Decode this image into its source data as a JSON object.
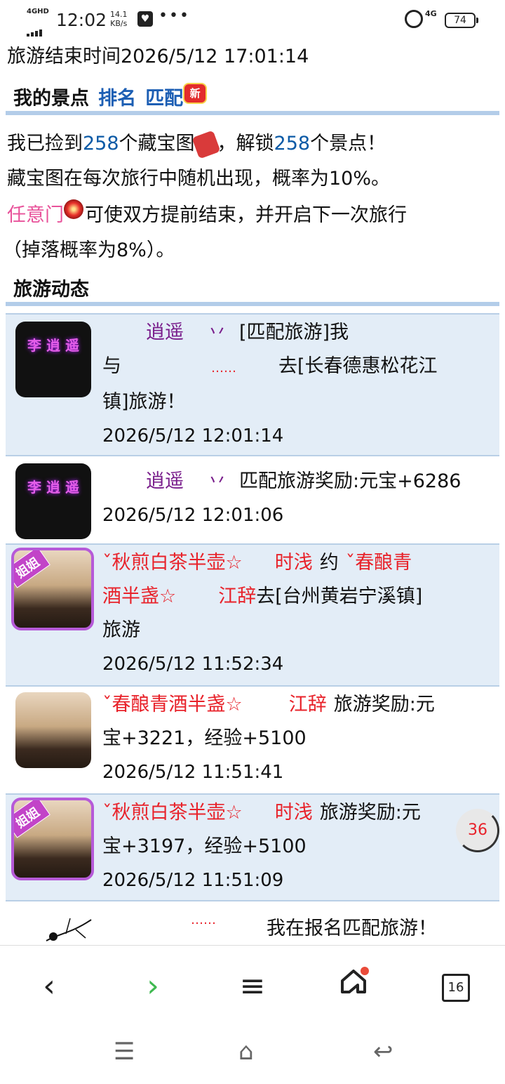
{
  "status": {
    "net": "4GHD",
    "time": "12:02",
    "speed_top": "14.1",
    "speed_bottom": "KB/s",
    "dots": "•••",
    "sig": "4G",
    "battery": "74"
  },
  "tour_end": "旅游结束时间2026/5/12 17:01:14",
  "scenic": {
    "title": "我的景点",
    "rank": "排名",
    "match": "匹配",
    "new_badge": "新",
    "line1_a": "我已捡到",
    "count1": "258",
    "line1_b": "个藏宝图",
    "line1_c": "，解锁",
    "count2": "258",
    "line1_d": "个景点！",
    "line2": "藏宝图在每次旅行中随机出现，概率为10%。",
    "portal": "任意门",
    "line3_b": "可使双方提前结束，并开启下一次旅行",
    "line4": "（掉落概率为8%）。"
  },
  "feed_title": "旅游动态",
  "feed": [
    {
      "n1": "逍遥",
      "mark": "丷",
      "t1": "[匹配旅游]我",
      "t2": "与",
      "dots": "……",
      "t3": "去[长春德惠松花江",
      "t4": "镇]旅游！",
      "time": "2026/5/12 12:01:14",
      "av_text": "李 逍 遥"
    },
    {
      "n1": "逍遥",
      "mark": "丷",
      "t1": "匹配旅游奖励:元宝+6286",
      "time": "2026/5/12 12:01:06",
      "av_text": "李 逍 遥"
    },
    {
      "badge": "姐姐",
      "n1": "ˇ秋煎白茶半壶☆",
      "n2": "时浅",
      "yue": "约",
      "n3": "ˇ春酿青",
      "n3b": "酒半盏☆",
      "n4": "江辞",
      "t1": "去[台州黄岩宁溪镇]",
      "t2": "旅游",
      "time": "2026/5/12 11:52:34"
    },
    {
      "n1": "ˇ春酿青酒半盏☆",
      "n2": "江辞",
      "t1": "旅游奖励:元",
      "t2": "宝+3221，经验+5100",
      "time": "2026/5/12 11:51:41"
    },
    {
      "badge": "姐姐",
      "n1": "ˇ秋煎白茶半壶☆",
      "n2": "时浅",
      "t1": "旅游奖励:元",
      "t2": "宝+3197，经验+5100",
      "time": "2026/5/12 11:51:09"
    },
    {
      "dots": "……",
      "t1": "我在报名匹配旅游！"
    }
  ],
  "float_count": "36",
  "nav": {
    "back": "‹",
    "forward": "›",
    "menu": "≡",
    "tabs": "16"
  },
  "sys": {
    "menu": "☰",
    "home": "⌂",
    "back": "↩"
  }
}
